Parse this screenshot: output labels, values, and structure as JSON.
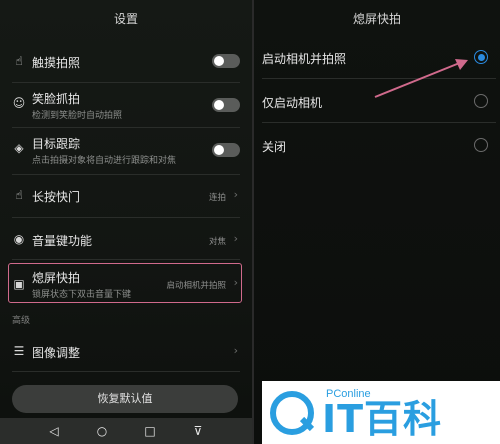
{
  "left": {
    "title": "设置",
    "rows": [
      {
        "label": "触摸拍照",
        "icon": "touch-hand-icon"
      },
      {
        "label": "笑脸抓拍",
        "sub": "检测到笑脸时自动拍照",
        "icon": "smile-icon"
      },
      {
        "label": "目标跟踪",
        "sub": "点击拍摄对象将自动进行跟踪和对焦",
        "icon": "target-icon"
      },
      {
        "label": "长按快门",
        "value": "连拍",
        "icon": "hand-press-icon"
      },
      {
        "label": "音量键功能",
        "value": "对焦",
        "icon": "volume-icon"
      },
      {
        "label": "熄屏快拍",
        "sub": "锁屏状态下双击音量下键",
        "value": "启动相机并拍照",
        "icon": "camera-icon"
      },
      {
        "label": "图像调整",
        "icon": "sliders-icon"
      }
    ],
    "section_label": "高级",
    "reset_label": "恢复默认值"
  },
  "right": {
    "title": "熄屏快拍",
    "options": [
      {
        "label": "启动相机并拍照",
        "selected": true
      },
      {
        "label": "仅启动相机",
        "selected": false
      },
      {
        "label": "关闭",
        "selected": false
      }
    ]
  },
  "logo": {
    "small": "PConline",
    "big": "IT百科"
  },
  "colors": {
    "accent": "#2a8be0",
    "highlight": "#d06a8c"
  }
}
